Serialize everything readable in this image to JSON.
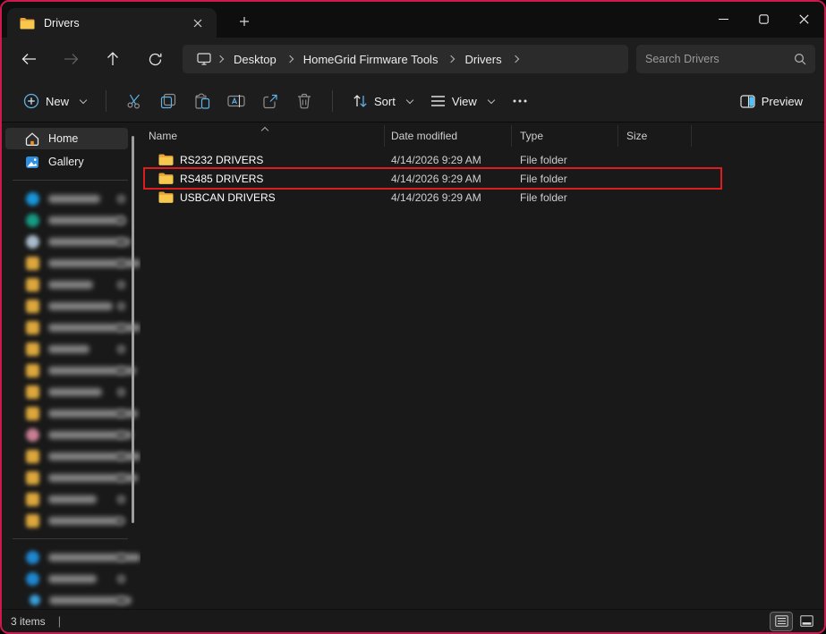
{
  "tab_bar": {
    "tab_label": "Drivers"
  },
  "nav": {
    "breadcrumb": [
      "Desktop",
      "HomeGrid Firmware Tools",
      "Drivers"
    ],
    "search_placeholder": "Search Drivers"
  },
  "toolbar": {
    "new_label": "New",
    "sort_label": "Sort",
    "view_label": "View",
    "preview_label": "Preview"
  },
  "sidebar": {
    "home_label": "Home",
    "gallery_label": "Gallery",
    "pinned_items": [
      {
        "icon": "cloud-blue",
        "text_width": 58
      },
      {
        "icon": "teal-circle",
        "text_width": 86
      },
      {
        "icon": "pc-gray",
        "text_width": 92
      },
      {
        "icon": "folder",
        "text_width": 104
      },
      {
        "icon": "folder",
        "text_width": 50
      },
      {
        "icon": "folder",
        "text_width": 72
      },
      {
        "icon": "folder",
        "text_width": 110
      },
      {
        "icon": "folder",
        "text_width": 46
      },
      {
        "icon": "folder",
        "text_width": 98
      },
      {
        "icon": "folder",
        "text_width": 60
      },
      {
        "icon": "folder",
        "text_width": 100
      },
      {
        "icon": "pink-circle",
        "text_width": 94
      },
      {
        "icon": "folder",
        "text_width": 112
      },
      {
        "icon": "folder",
        "text_width": 100
      },
      {
        "icon": "folder",
        "text_width": 54
      },
      {
        "icon": "folder",
        "text_width": 82
      }
    ],
    "bottom_items": [
      {
        "icon": "blue-circle",
        "text_width": 104
      },
      {
        "icon": "blue-circle",
        "text_width": 54
      },
      {
        "icon": "blue-small",
        "text_width": 92
      }
    ]
  },
  "file_list": {
    "columns": [
      "Name",
      "Date modified",
      "Type",
      "Size"
    ],
    "sorted_column": "Name",
    "rows": [
      {
        "name": "RS232 DRIVERS",
        "date_modified": "4/14/2026 9:29 AM",
        "type": "File folder",
        "size": "",
        "highlighted": false
      },
      {
        "name": "RS485 DRIVERS",
        "date_modified": "4/14/2026 9:29 AM",
        "type": "File folder",
        "size": "",
        "highlighted": true
      },
      {
        "name": "USBCAN DRIVERS",
        "date_modified": "4/14/2026 9:29 AM",
        "type": "File folder",
        "size": "",
        "highlighted": false
      }
    ]
  },
  "status_bar": {
    "items_count": "3 items"
  },
  "colors": {
    "accent": "#5fb2e6",
    "annotation_red": "#dc1d1d",
    "window_border": "#cc1a4e",
    "folder_back": "#e8a33b",
    "folder_front": "#f6c94e"
  }
}
